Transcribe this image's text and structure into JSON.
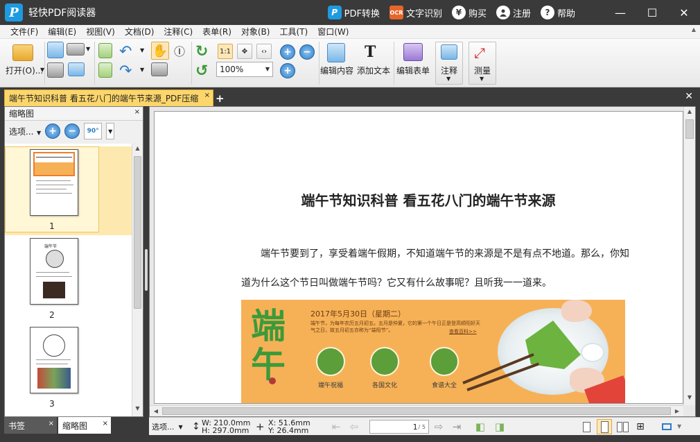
{
  "app": {
    "title": "轻快PDF阅读器",
    "logo_letter": "P"
  },
  "title_actions": [
    {
      "label": "PDF转换",
      "icon": "pdf-convert-icon",
      "glyph": "P"
    },
    {
      "label": "文字识别",
      "icon": "ocr-icon",
      "glyph": "OCR"
    },
    {
      "label": "购买",
      "icon": "yen-icon",
      "glyph": "¥"
    },
    {
      "label": "注册",
      "icon": "user-icon",
      "glyph": "👤"
    },
    {
      "label": "帮助",
      "icon": "help-icon",
      "glyph": "?"
    }
  ],
  "window_controls": {
    "minimize": "—",
    "maximize": "☐",
    "close": "✕"
  },
  "menu": [
    "文件(F)",
    "编辑(E)",
    "视图(V)",
    "文档(D)",
    "注释(C)",
    "表单(R)",
    "对象(B)",
    "工具(T)",
    "窗口(W)"
  ],
  "toolbar": {
    "open_label": "打开(O)...",
    "zoom_value": "100%",
    "fit_page_label": "1:1",
    "edit_content_label": "编辑内容",
    "add_text_label": "添加文本",
    "edit_form_label": "编辑表单",
    "annotate_label": "注释",
    "measure_label": "测量"
  },
  "tabs": {
    "active_document": "端午节知识科普 看五花八门的端午节来源_PDF压缩",
    "close": "×",
    "add": "+"
  },
  "left_panel": {
    "title": "缩略图",
    "options_label": "选项...",
    "rotate_label": "90°",
    "pages": [
      {
        "number": "1",
        "selected": true
      },
      {
        "number": "2",
        "selected": false
      },
      {
        "number": "3",
        "selected": false
      }
    ],
    "thumb2_caption": "端午节",
    "bottom_tabs": [
      "书签",
      "缩略图"
    ]
  },
  "document": {
    "title": "端午节知识科普  看五花八门的端午节来源",
    "paragraph_line1": "端午节要到了，享受着端午假期，不知道端午节的来源是不是有点不地道。那么，你知",
    "paragraph_line2": "道为什么这个节日叫做端午节吗？它又有什么故事呢？且听我一一道来。",
    "banner": {
      "hero_text": "端午",
      "date": "2017年5月30日（星期二）",
      "desc": "端午节，为每年农历五月初五。五月是仲夏，它的第一个午日正是登高顺阳好天气之日，故五月初五亦称为“端阳节”。",
      "more": "查看百科>>",
      "captions": [
        "端午祝福",
        "各国文化",
        "食谱大全"
      ]
    }
  },
  "statusbar": {
    "options_label": "选项...",
    "width": "W:  210.0mm",
    "height": "H:  297.0mm",
    "x": "X:     51.6mm",
    "y": "Y:     26.4mm",
    "current_page": "1",
    "total_pages": "/ 5"
  },
  "colors": {
    "accent_tab": "#fcd66b",
    "title_bg": "#3a3a3a",
    "banner_bg": "#f6b157",
    "banner_green": "#3d9a3a"
  }
}
